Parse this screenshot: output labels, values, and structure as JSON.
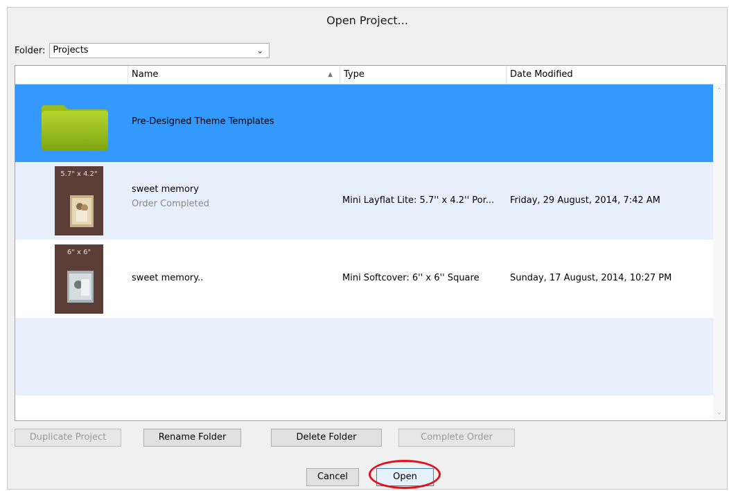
{
  "window": {
    "title": "Open Project..."
  },
  "folder": {
    "label": "Folder:",
    "value": "Projects"
  },
  "columns": {
    "name": "Name",
    "type": "Type",
    "date": "Date Modified"
  },
  "rows": [
    {
      "name": "Pre-Designed Theme Templates",
      "sub": "",
      "type": "",
      "date": ""
    },
    {
      "name": "sweet memory",
      "sub": "Order Completed",
      "type": "Mini Layflat Lite: 5.7'' x 4.2'' Por...",
      "date": "Friday, 29 August, 2014, 7:42 AM",
      "thumb_label": "5.7\" x 4.2\""
    },
    {
      "name": "sweet memory..",
      "sub": "",
      "type": "Mini Softcover: 6'' x 6'' Square",
      "date": "Sunday, 17 August, 2014, 10:27 PM",
      "thumb_label": "6\" x 6\""
    }
  ],
  "buttons": {
    "duplicate": "Duplicate Project",
    "rename": "Rename Folder",
    "delete": "Delete Folder",
    "complete": "Complete Order",
    "cancel": "Cancel",
    "open": "Open"
  },
  "colors": {
    "selected": "#3399ff",
    "alt_row": "#e8f0fb",
    "annotation": "#e0101c"
  }
}
